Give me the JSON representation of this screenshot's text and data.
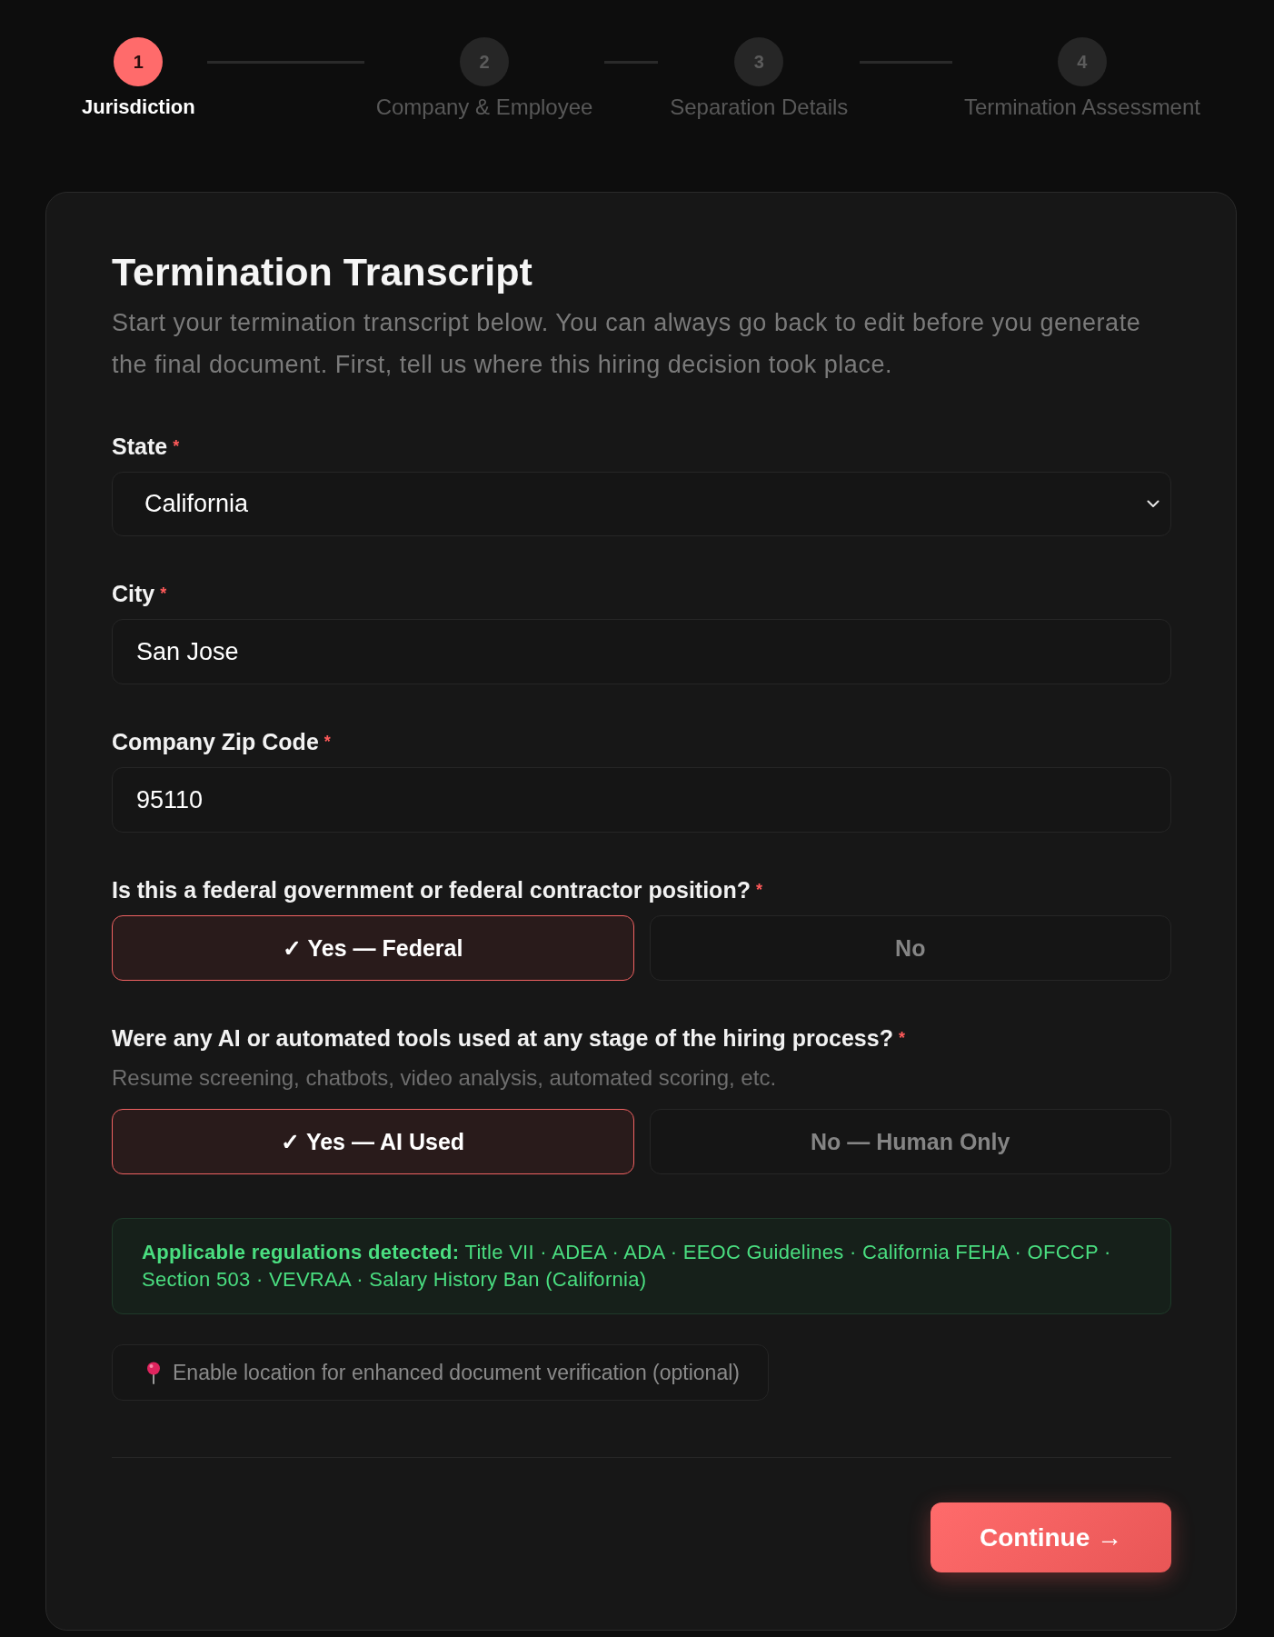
{
  "stepper": {
    "steps": [
      {
        "number": "1",
        "label": "Jurisdiction",
        "selected": true
      },
      {
        "number": "2",
        "label": "Company & Employee",
        "selected": false
      },
      {
        "number": "3",
        "label": "Separation Details",
        "selected": false
      },
      {
        "number": "4",
        "label": "Termination Assessment",
        "selected": false
      }
    ]
  },
  "form": {
    "title": "Termination Transcript",
    "intro": "Start your termination transcript below. You can always go back to edit before you generate the final document. First, tell us where this hiring decision took place.",
    "fields": [
      {
        "kind": "select",
        "label": "State",
        "required_mark": "*",
        "value": "California"
      },
      {
        "kind": "text",
        "label": "City",
        "required_mark": "*",
        "value": "San Jose"
      },
      {
        "kind": "text",
        "label": "Company Zip Code",
        "required_mark": "*",
        "value": "95110"
      }
    ],
    "questions": [
      {
        "label": "Is this a federal government or federal contractor position?",
        "required_mark": "*",
        "options": [
          {
            "label": "✓ Yes — Federal",
            "selected": true
          },
          {
            "label": "No",
            "selected": false
          }
        ]
      },
      {
        "label": "Were any AI or automated tools used at any stage of the hiring process?",
        "required_mark": "*",
        "hint": "Resume screening, chatbots, video analysis, automated scoring, etc.",
        "options": [
          {
            "label": "✓ Yes — AI Used",
            "selected": true
          },
          {
            "label": "No — Human Only",
            "selected": false
          }
        ]
      }
    ],
    "regulations_notice": "**Applicable regulations detected:** Title VII · ADEA · ADA · EEOC Guidelines · California FEHA · OFCCP · Section 503 · VEVRAA · Salary History Ban (California)",
    "location_button": {
      "label": "Enable location for enhanced document verification (optional)"
    },
    "continue_button": {
      "label": "Continue →"
    }
  }
}
